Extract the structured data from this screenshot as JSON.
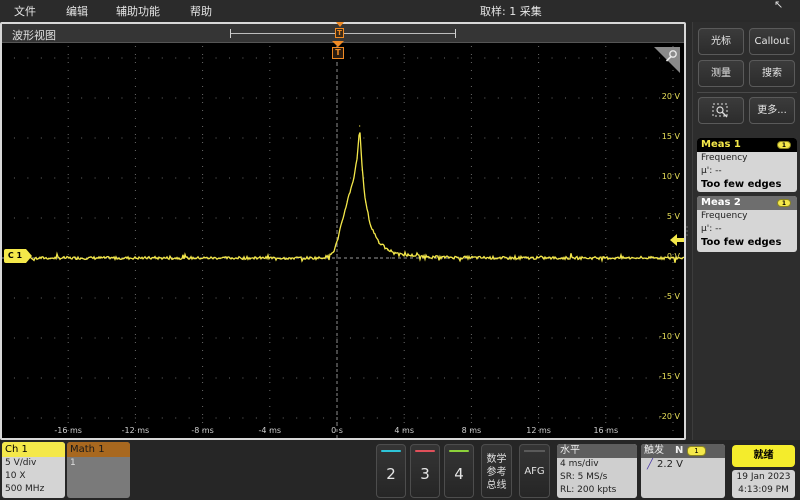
{
  "menubar": {
    "items": [
      "文件",
      "编辑",
      "辅助功能",
      "帮助"
    ],
    "acquisition_status": "取样: 1 采集",
    "cursor_icon": "mouse-pointer-icon"
  },
  "waveform_view": {
    "title": "波形视图",
    "trigger_marker_label": "T",
    "channel_marker_label": "C 1",
    "zoom_icon": "zoom-magnifier-icon",
    "colors": {
      "ch1": "#f4e84a",
      "trigger": "#f08a24",
      "ch2": "#2ec4d8",
      "ch3": "#e0505a",
      "ch4": "#8cd23a",
      "math": "#a8681f"
    }
  },
  "chart_data": {
    "type": "line",
    "title": "",
    "xlabel": "",
    "ylabel": "",
    "x_unit": "ms",
    "y_unit": "V",
    "xlim": [
      -20,
      20
    ],
    "ylim": [
      -25,
      25
    ],
    "x_ticks": [
      -16,
      -12,
      -8,
      -4,
      0,
      4,
      8,
      12,
      16
    ],
    "x_tick_labels": [
      "-16 ms",
      "-12 ms",
      "-8 ms",
      "-4 ms",
      "0 s",
      "4 ms",
      "8 ms",
      "12 ms",
      "16 ms"
    ],
    "y_ticks": [
      20,
      15,
      10,
      5,
      0,
      -5,
      -10,
      -15,
      -20
    ],
    "y_tick_labels": [
      "20 V",
      "15 V",
      "10 V",
      "5 V",
      "0 V",
      "-5 V",
      "-10 V",
      "-15 V",
      "-20 V"
    ],
    "grid": true,
    "series": [
      {
        "name": "Ch 1",
        "x": [
          -20,
          -1.0,
          -0.5,
          -0.2,
          0,
          0.3,
          0.6,
          0.8,
          1.0,
          1.2,
          1.35,
          1.5,
          1.7,
          2.0,
          2.5,
          3.0,
          4.0,
          6.0,
          10.0,
          20.0
        ],
        "y": [
          0,
          0,
          0.2,
          0.8,
          2.0,
          4.5,
          7.0,
          8.5,
          10.0,
          12.5,
          16.5,
          11.0,
          7.0,
          4.0,
          2.0,
          1.0,
          0.4,
          0.1,
          0,
          0
        ]
      }
    ]
  },
  "right_panel": {
    "buttons": [
      {
        "label": "光标",
        "name": "cursors-button"
      },
      {
        "label": "Callout",
        "name": "callout-button"
      },
      {
        "label": "测量",
        "name": "measure-button"
      },
      {
        "label": "搜索",
        "name": "search-button"
      },
      {
        "label": "",
        "name": "zoom-tool-button",
        "icon": "zoom-box-icon"
      },
      {
        "label": "更多...",
        "name": "more-button"
      }
    ],
    "measurements": [
      {
        "title": "Meas 1",
        "source": "1",
        "type": "Frequency",
        "mean": "μ': --",
        "status": "Too few edges"
      },
      {
        "title": "Meas 2",
        "source": "1",
        "type": "Frequency",
        "mean": "μ': --",
        "status": "Too few edges"
      }
    ]
  },
  "bottom_bar": {
    "ch1": {
      "title": "Ch 1",
      "scale": "5 V/div",
      "probe": "10 X",
      "bandwidth": "500 MHz"
    },
    "math1": {
      "title": "Math 1",
      "value": "1"
    },
    "channel_buttons": [
      "2",
      "3",
      "4"
    ],
    "math_ref_bus_label": [
      "数学",
      "参考",
      "总线"
    ],
    "afg_label": "AFG",
    "horizontal": {
      "title": "水平",
      "scale": "4 ms/div",
      "sample_rate": "SR: 5 MS/s",
      "record_length": "RL: 200 kpts"
    },
    "trigger": {
      "title": "触发",
      "mode": "N",
      "source": "1",
      "level": "2.2 V",
      "slope_icon": "rising-edge-icon"
    },
    "ready_label": "就绪",
    "date": "19 Jan 2023",
    "time": "4:13:09 PM"
  }
}
